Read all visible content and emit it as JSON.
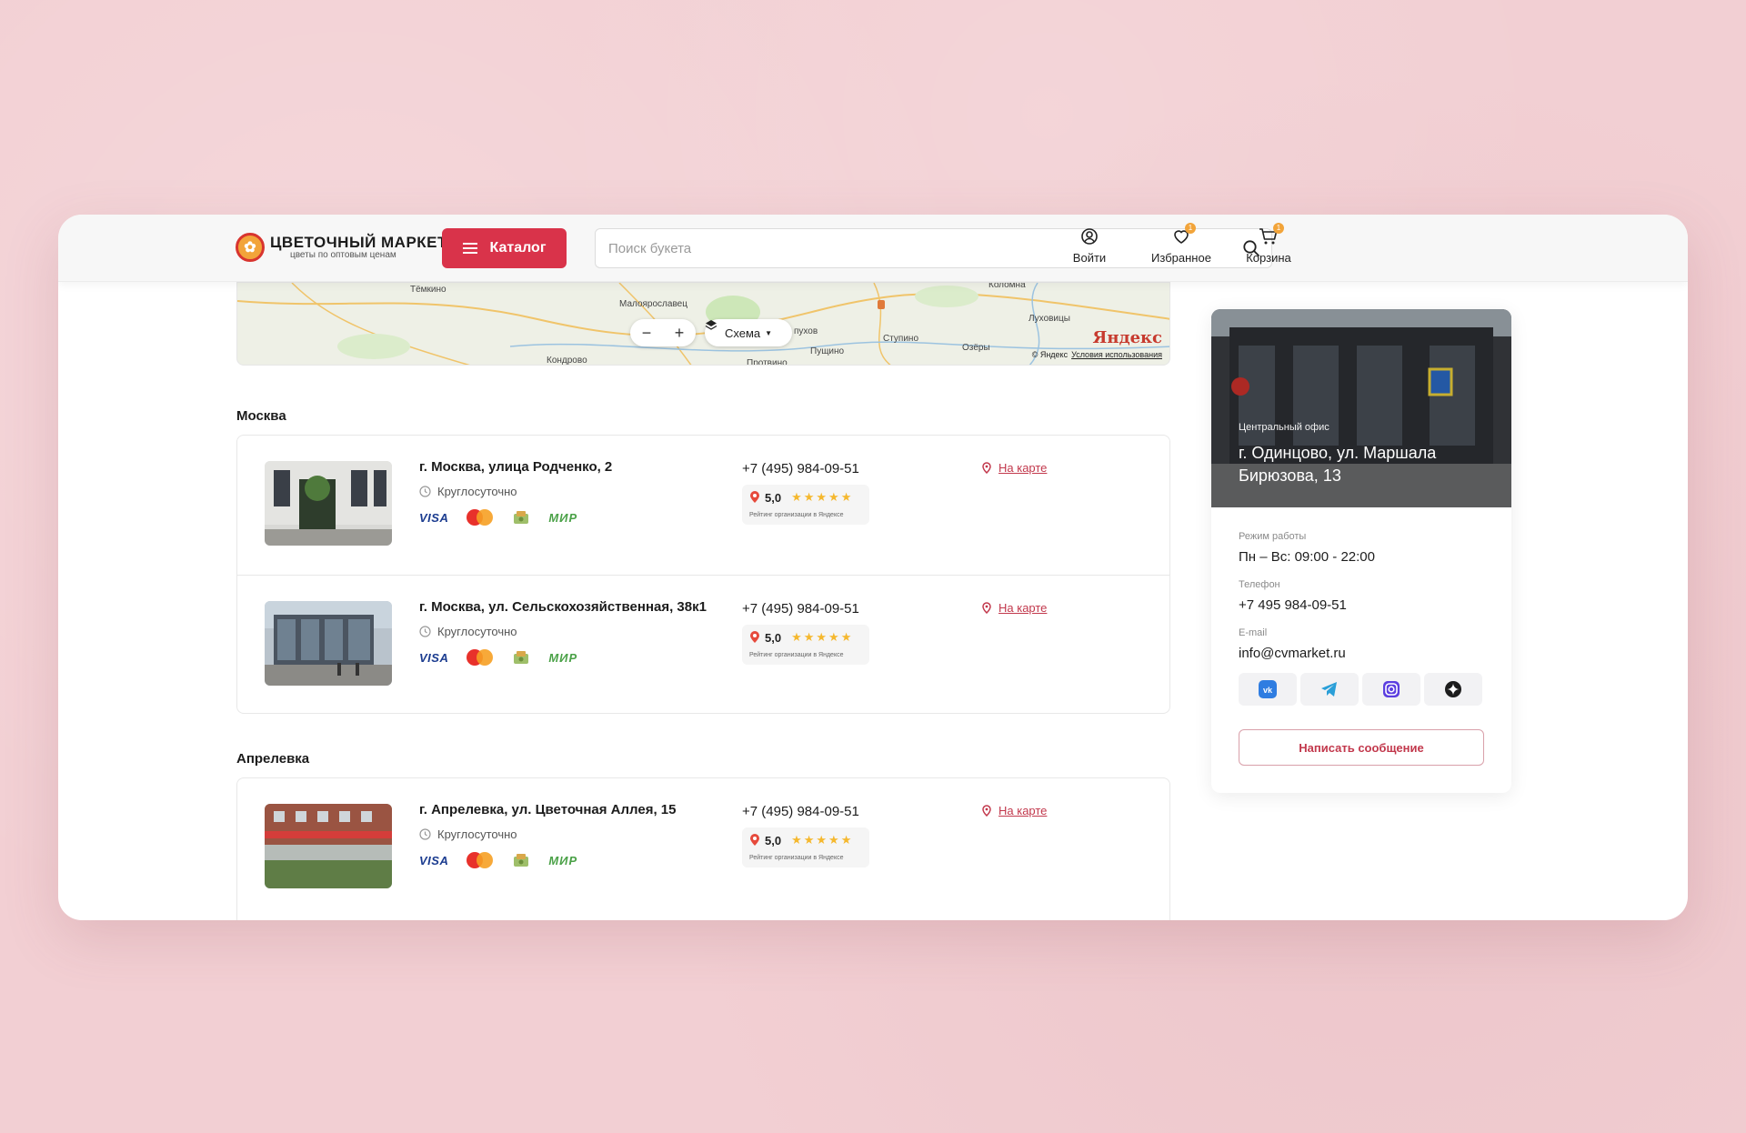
{
  "header": {
    "logo_title": "ЦВЕТОЧНЫЙ МАРКЕТ",
    "logo_subtitle": "цветы по оптовым ценам",
    "catalog_label": "Каталог",
    "search_placeholder": "Поиск букета",
    "login_label": "Войти",
    "favorites_label": "Избранное",
    "favorites_count": "1",
    "cart_label": "Корзина",
    "cart_count": "1"
  },
  "map": {
    "towns": [
      "Тёмкино",
      "Малоярославец",
      "Коломна",
      "Луховицы",
      "Ступино",
      "Озёры",
      "Кондрово",
      "Протвино",
      "Пущино",
      "пухов"
    ],
    "zoom_out": "−",
    "zoom_in": "+",
    "layer_label": "Схема",
    "brand": "Яндекс",
    "copyright": "© Яндекс",
    "terms": "Условия использования"
  },
  "sections": [
    {
      "title": "Москва",
      "stores": [
        {
          "address": "г. Москва, улица Родченко, 2",
          "hours": "Круглосуточно",
          "phone": "+7 (495) 984-09-51",
          "rating": "5,0",
          "rating_caption": "Рейтинг организации в Яндексе",
          "map_link": "На карте",
          "payments": [
            "VISA",
            "mastercard",
            "cash",
            "МИР"
          ]
        },
        {
          "address": "г. Москва, ул. Сельскохозяйственная, 38к1",
          "hours": "Круглосуточно",
          "phone": "+7 (495) 984-09-51",
          "rating": "5,0",
          "rating_caption": "Рейтинг организации в Яндексе",
          "map_link": "На карте",
          "payments": [
            "VISA",
            "mastercard",
            "cash",
            "МИР"
          ]
        }
      ]
    },
    {
      "title": "Апрелевка",
      "stores": [
        {
          "address": "г. Апрелевка, ул. Цветочная Аллея, 15",
          "hours": "Круглосуточно",
          "phone": "+7 (495) 984-09-51",
          "rating": "5,0",
          "rating_caption": "Рейтинг организации в Яндексе",
          "map_link": "На карте",
          "payments": [
            "VISA",
            "mastercard",
            "cash",
            "МИР"
          ]
        }
      ]
    }
  ],
  "office": {
    "tag": "Центральный офис",
    "address": "г. Одинцово, ул. Маршала Бирюзова, 13",
    "hours_label": "Режим работы",
    "hours_value": "Пн – Вс: 09:00 - 22:00",
    "phone_label": "Телефон",
    "phone_value": "+7 495 984-09-51",
    "email_label": "E-mail",
    "email_value": "info@cvmarket.ru",
    "socials": [
      "vk-icon",
      "telegram-icon",
      "instagram-icon",
      "zen-icon"
    ],
    "message_button": "Написать сообщение"
  },
  "colors": {
    "accent": "#d9334a",
    "link": "#c2384c",
    "badge": "#f2a43a",
    "star": "#f5b82e",
    "background": "#f2cfd3"
  }
}
